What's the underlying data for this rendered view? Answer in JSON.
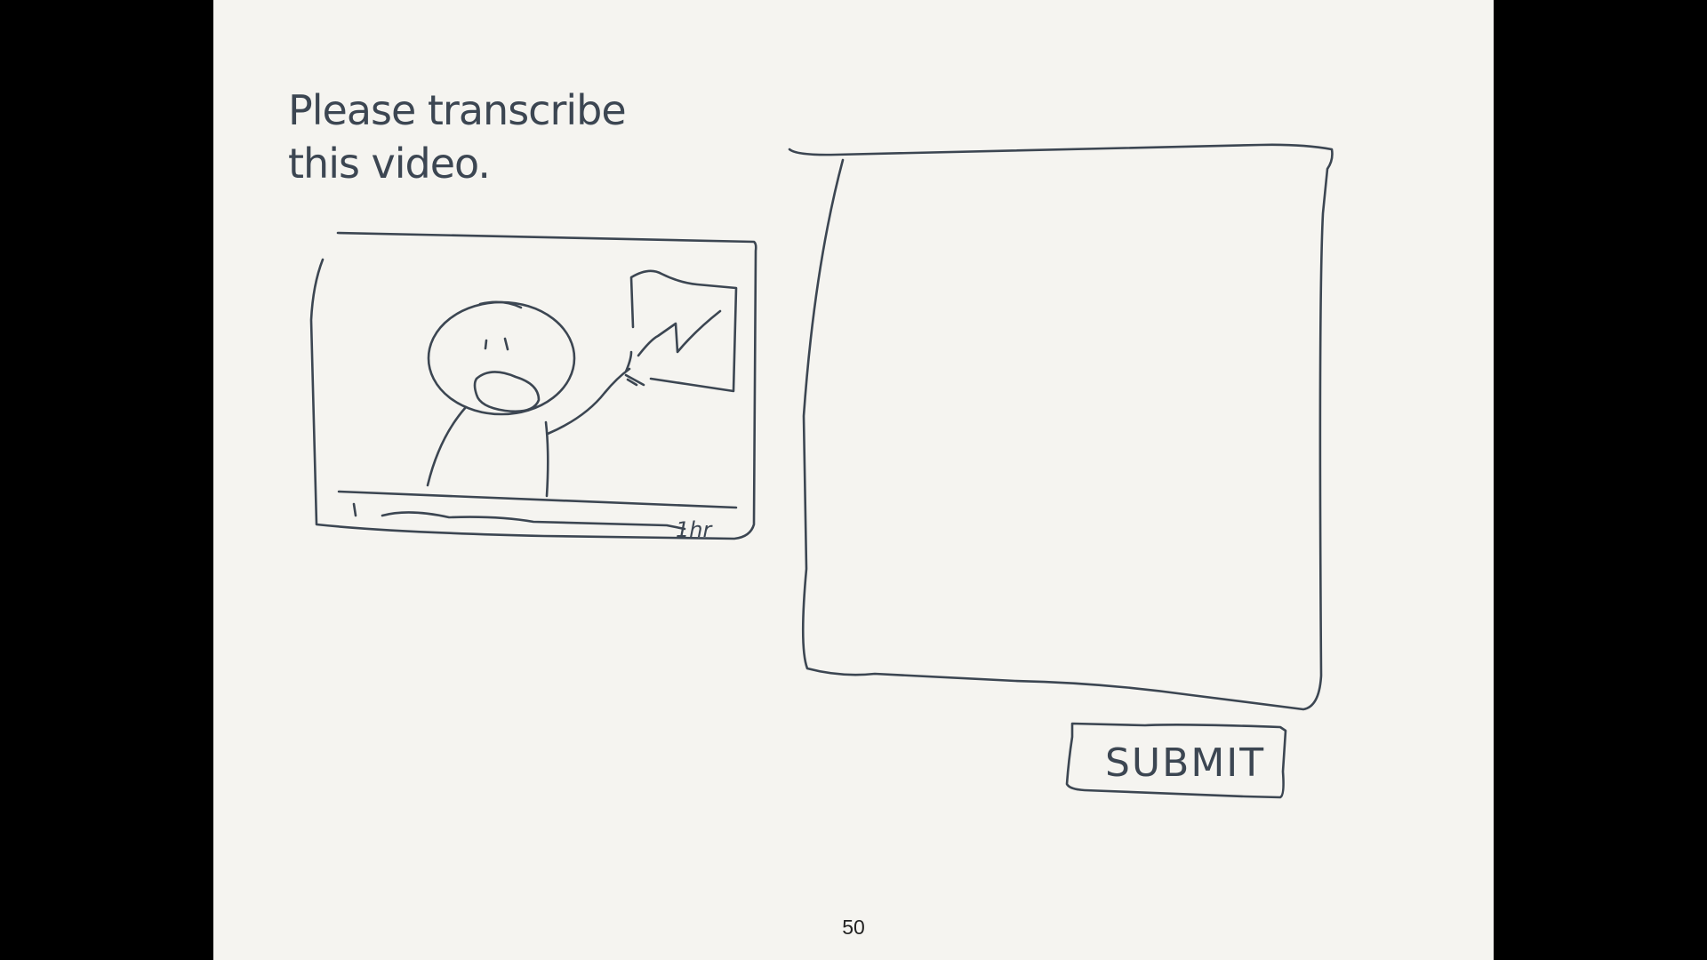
{
  "prompt": {
    "line1": "Please transcribe",
    "line2": "this video."
  },
  "video_player": {
    "duration_label": "1hr"
  },
  "transcription_box": {
    "value": ""
  },
  "submit_label": "SUBMIT",
  "page_number": "50",
  "colors": {
    "ink": "#3c4652",
    "paper": "#f5f4f0",
    "frame": "#000000"
  }
}
